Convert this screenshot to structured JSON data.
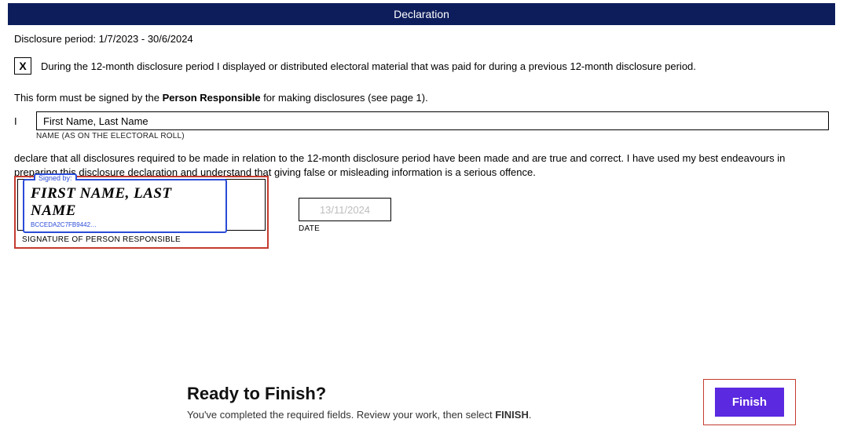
{
  "header": {
    "title": "Declaration"
  },
  "period": {
    "label": "Disclosure period:",
    "value": "1/7/2023 - 30/6/2024"
  },
  "checkbox": {
    "mark": "X",
    "text": "During the 12-month disclosure period I displayed or distributed electoral material that was paid for during a previous 12-month disclosure period."
  },
  "signNote": {
    "prefix": "This form must be signed by the ",
    "bold": "Person Responsible",
    "suffix": " for making disclosures (see page 1)."
  },
  "name": {
    "iLabel": "I",
    "value": "First Name, Last Name",
    "caption": "NAME (AS ON THE ELECTORAL ROLL)"
  },
  "declareText": "declare that all disclosures required to be made in relation to the 12-month disclosure period have been made and are true and correct. I have used my best endeavours in preparing this disclosure declaration and understand that giving false or misleading information is a serious offence.",
  "signature": {
    "signedByLabel": "Signed by:",
    "sigText": "FIRST NAME, LAST NAME",
    "sigId": "BCCEDA2C7FB9442…",
    "caption": "SIGNATURE OF PERSON RESPONSIBLE"
  },
  "date": {
    "value": "13/11/2024",
    "caption": "DATE"
  },
  "footer": {
    "title": "Ready to Finish?",
    "subPrefix": "You've completed the required fields. Review your work, then select ",
    "subBold": "FINISH",
    "subSuffix": ".",
    "finishLabel": "Finish"
  }
}
